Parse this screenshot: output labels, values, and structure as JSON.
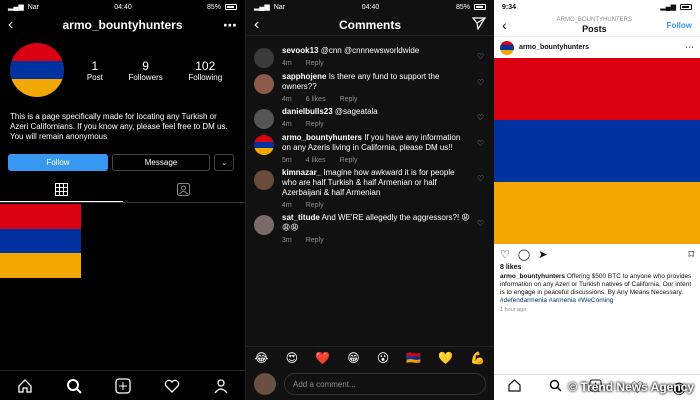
{
  "colors": {
    "flag_red": "#d90012",
    "flag_blue": "#0033a0",
    "flag_orange": "#f2a800",
    "accent": "#3897f0"
  },
  "panel1": {
    "status": {
      "carrier": "Nar",
      "time": "04:40",
      "battery": "85%"
    },
    "header": {
      "username": "armo_bountyhunters",
      "back_icon": "chevron-left-icon",
      "more_icon": "ellipsis-icon"
    },
    "stats": [
      {
        "num": "1",
        "label": "Post"
      },
      {
        "num": "9",
        "label": "Followers"
      },
      {
        "num": "102",
        "label": "Following"
      }
    ],
    "bio": "This is a page specifically made for locating any Turkish or Azeri Californians. If you know any, please feel free to DM us. You will remain anonymous",
    "buttons": {
      "follow": "Follow",
      "message": "Message"
    }
  },
  "panel2": {
    "status": {
      "carrier": "Nar",
      "time": "04:40",
      "battery": "85%"
    },
    "header": {
      "title": "Comments"
    },
    "comments": [
      {
        "user": "sevook13",
        "text": "@cnn @cnnnewsworldwide",
        "time": "4m",
        "likes": "",
        "reply": "Reply",
        "avatar": "#3a3a3a"
      },
      {
        "user": "sapphojene",
        "text": "Is there any fund to support the owners??",
        "time": "4m",
        "likes": "6 likes",
        "reply": "Reply",
        "avatar": "#8a5a4a"
      },
      {
        "user": "danielbulls23",
        "text": "@sageatala",
        "time": "4m",
        "likes": "",
        "reply": "Reply",
        "avatar": "#555"
      },
      {
        "user": "armo_bountyhunters",
        "text": "If you have any information on any Azeris living in California, please DM us!!",
        "time": "5m",
        "likes": "4 likes",
        "reply": "Reply",
        "avatar": "flag"
      },
      {
        "user": "kimnazar_",
        "text": "Imagine how awkward it is for people who are half Turkish & half Armenian or half Azerbaijani & half Armenian",
        "time": "4m",
        "likes": "",
        "reply": "Reply",
        "avatar": "#6b4a3a"
      },
      {
        "user": "sat_titude",
        "text": "And WE'RE allegedly the aggressors?! 😩😩😩",
        "time": "3m",
        "likes": "",
        "reply": "Reply",
        "avatar": "#7a6a6a"
      }
    ],
    "emojis": [
      "😂",
      "😍",
      "❤️",
      "😁",
      "😮",
      "🇦🇲",
      "💛",
      "💪"
    ],
    "add_comment_placeholder": "Add a comment..."
  },
  "panel3": {
    "status": {
      "time": "9:34"
    },
    "header": {
      "username": "ARMO_BOUNTYHUNTERS",
      "title": "Posts",
      "follow": "Follow"
    },
    "post": {
      "user": "armo_bountyhunters",
      "likes": "8 likes",
      "caption_user": "armo_bountyhunters",
      "caption_text": "Offering $500 BTC to anyone who provides information on any Azeri or Turkish natives of California. Our intent is to engage in peaceful discussions. By Any Means Necessary.",
      "caption_tags": "#defendarmenia #armenia #WeComing",
      "time": "1 hour ago"
    },
    "watermark": "© Trend News Agency"
  }
}
